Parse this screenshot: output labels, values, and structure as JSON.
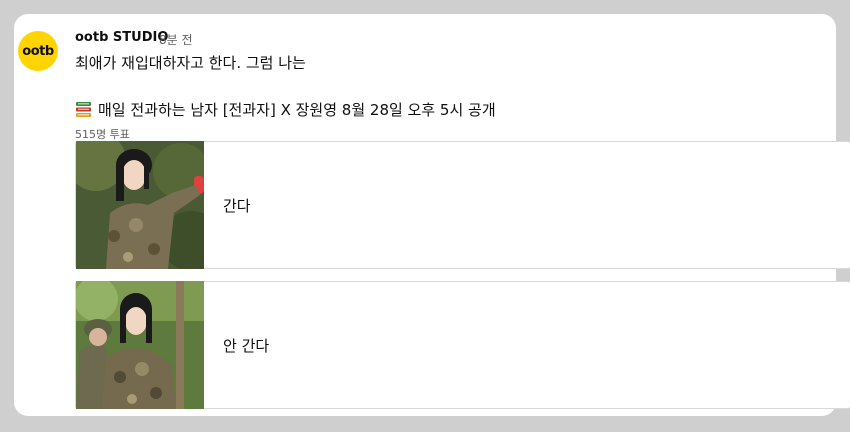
{
  "channel": {
    "avatar_text": "ootb",
    "name": "ootb STUDIO",
    "time": "8분 전"
  },
  "post": {
    "text": "최애가 재입대하자고 한다. 그럼 나는",
    "promo_icon": "books-icon",
    "promo": "매일 전과하는 남자 [전과자] X 장원영 8월 28일 오후 5시 공개",
    "votes": "515명 투표"
  },
  "poll": {
    "options": [
      {
        "label": "간다"
      },
      {
        "label": "안 간다"
      }
    ]
  },
  "colors": {
    "avatar": "#ffd400",
    "background": "#cfcfcf",
    "card": "#ffffff",
    "border": "#d9d9d9"
  }
}
